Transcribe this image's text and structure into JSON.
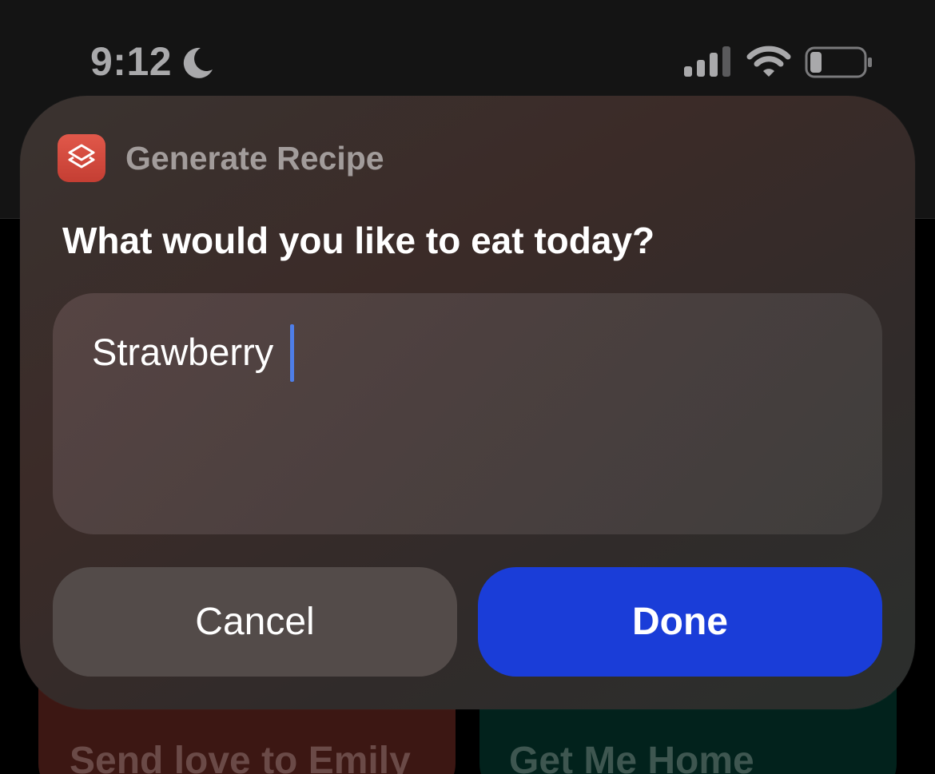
{
  "status_bar": {
    "time": "9:12",
    "focus_icon": "moon-icon",
    "signal_icon": "cellular-signal-icon",
    "wifi_icon": "wifi-icon",
    "battery_icon": "battery-low-icon"
  },
  "background_tiles": [
    {
      "label": "Send love to Emily",
      "color": "#3c1713"
    },
    {
      "label": "Get Me Home",
      "color": "#02221c"
    }
  ],
  "dialog": {
    "app_icon": "shortcuts-icon",
    "app_name": "Generate Recipe",
    "prompt": "What would you like to eat today?",
    "input_value": "Strawberry",
    "cancel_label": "Cancel",
    "done_label": "Done"
  },
  "colors": {
    "accent": "#1a3dd8",
    "caret": "#4e7ee8",
    "app_icon": "#d64b40"
  }
}
